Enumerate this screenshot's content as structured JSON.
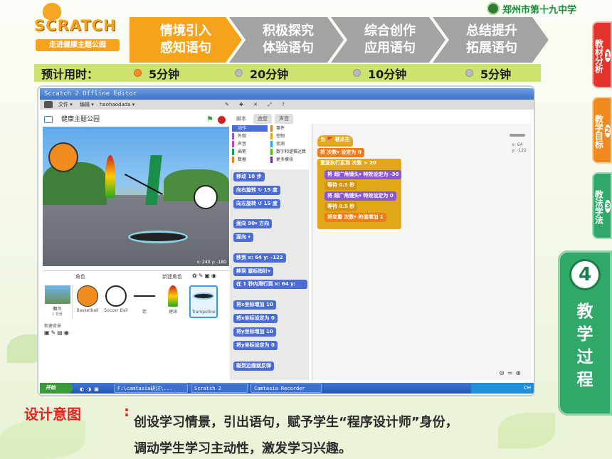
{
  "header": {
    "logo": {
      "title": "SCRATCH",
      "subtitle": "走进健康主题公园"
    },
    "school": "郑州市第十九中学"
  },
  "steps": [
    {
      "line1": "情境引入",
      "line2": "感知语句",
      "active": true
    },
    {
      "line1": "积极探究",
      "line2": "体验语句",
      "active": false
    },
    {
      "line1": "综合创作",
      "line2": "应用语句",
      "active": false
    },
    {
      "line1": "总结提升",
      "line2": "拓展语句",
      "active": false
    }
  ],
  "timebar": {
    "label": "预计用时：",
    "times": [
      {
        "text": "5分钟",
        "active": true
      },
      {
        "text": "20分钟",
        "active": false
      },
      {
        "text": "10分钟",
        "active": false
      },
      {
        "text": "5分钟",
        "active": false
      }
    ]
  },
  "right_tabs": [
    {
      "num": "1",
      "label": "教材分析",
      "color": "#e2342a"
    },
    {
      "num": "2",
      "label": "教学目标",
      "color": "#f18a1e"
    },
    {
      "num": "3",
      "label": "教法学法",
      "color": "#2fa86a"
    }
  ],
  "big_tab": {
    "num": "4",
    "label": "教学过程"
  },
  "scratch": {
    "window_title": "Scratch 2 Offline Editor",
    "menu": {
      "file": "文件 ▾",
      "edit": "编辑 ▾",
      "user": "haohaodada ▾"
    },
    "project_title": "健康主题公园",
    "tabs": [
      "脚本",
      "造型",
      "声音"
    ],
    "sprites_header": {
      "label": "角色",
      "new": "新建角色"
    },
    "stage_label": "舞台",
    "stage_sub": "1 背景",
    "new_backdrop": "新建背景",
    "coords": "x: 240  y: -180",
    "sprites": [
      "Basketball",
      "Soccer Ball",
      "箭",
      "建球",
      "Trampoline"
    ],
    "categories": [
      "动作",
      "外观",
      "声音",
      "画笔",
      "数据",
      "事件",
      "控制",
      "侦测",
      "数字和逻辑运算",
      "更多模块"
    ],
    "palette_blocks": [
      "移动 10 步",
      "向右旋转 ↻ 15 度",
      "向左旋转 ↺ 15 度",
      "面向 90▾ 方向",
      "面向 ▾",
      "移到 x: 64 y: -122",
      "移到 鼠标指针▾",
      "在 1 秒内滑行到 x: 64 y:",
      "将x坐标增加 10",
      "将x坐标设定为 0",
      "将y坐标增加 10",
      "将y坐标设定为 0",
      "碰到边缘就反弹"
    ],
    "script_blocks": [
      "当 🚩 被点击",
      "将 次数▾ 设定为 0",
      "重复执行直到 次数 > 20",
      "将 超广角镜头▾ 特效设定为 -30",
      "等待 0.5 秒",
      "将 超广角镜头▾ 特效设定为 0",
      "等待 0.5 秒",
      "将变量 次数▾ 的值增加 1"
    ],
    "sprite_info": "x: 64\ny: -122",
    "taskbar": {
      "start": "开始",
      "items": [
        "F:\\camtasia研讨\\...",
        "Scratch 2 Offlin...",
        "Camtasia Recorder"
      ],
      "clock": "CH"
    }
  },
  "intent": {
    "heading": "设计意图",
    "colon": ":",
    "line1": "创设学习情景，引出语句，赋予学生“程序设计师”身份，",
    "line2": "调动学生学习主动性，激发学习兴趣。"
  }
}
